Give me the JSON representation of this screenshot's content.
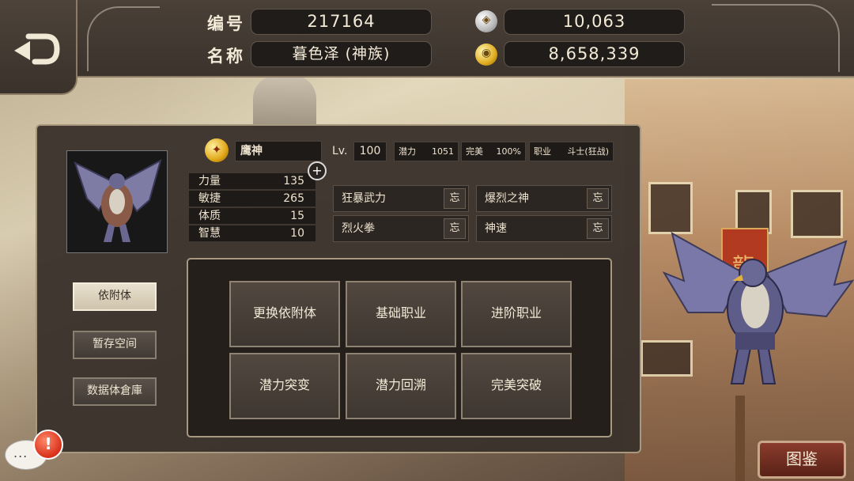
{
  "header": {
    "id_label": "编号",
    "id_value": "217164",
    "name_label": "名称",
    "name_value": "暮色泽 (神族)",
    "silver_amount": "10,063",
    "gold_amount": "8,658,339",
    "silver_icon": "silver-coin-icon",
    "gold_icon": "gold-coin-icon"
  },
  "character": {
    "name": "鹰神",
    "level_label": "Lv.",
    "level": "100",
    "potential_label": "潜力",
    "potential": "1051",
    "perfect_label": "完美",
    "perfect": "100%",
    "job_label": "职业",
    "job": "斗士(狂战)",
    "stats": [
      {
        "label": "力量",
        "value": "135"
      },
      {
        "label": "敏捷",
        "value": "265"
      },
      {
        "label": "体质",
        "value": "15"
      },
      {
        "label": "智慧",
        "value": "10"
      }
    ],
    "plus": "+"
  },
  "skills": [
    {
      "name": "狂暴武力",
      "action": "忘"
    },
    {
      "name": "爆烈之神",
      "action": "忘"
    },
    {
      "name": "烈火拳",
      "action": "忘"
    },
    {
      "name": "神速",
      "action": "忘"
    }
  ],
  "sidebar": [
    {
      "label": "依附体"
    },
    {
      "label": "暂存空间"
    },
    {
      "label": "数据体倉庫"
    }
  ],
  "actions": [
    {
      "label": "更换依附体"
    },
    {
      "label": "基础职业"
    },
    {
      "label": "进阶职业"
    },
    {
      "label": "潜力突变"
    },
    {
      "label": "潜力回溯"
    },
    {
      "label": "完美突破"
    }
  ],
  "footer": {
    "dex_label": "图鉴",
    "chat_dots": "...",
    "alert": "!"
  },
  "colors": {
    "panel": "#3a322c",
    "accent_gold": "#e0ac20",
    "dex_button": "#7a3424"
  }
}
